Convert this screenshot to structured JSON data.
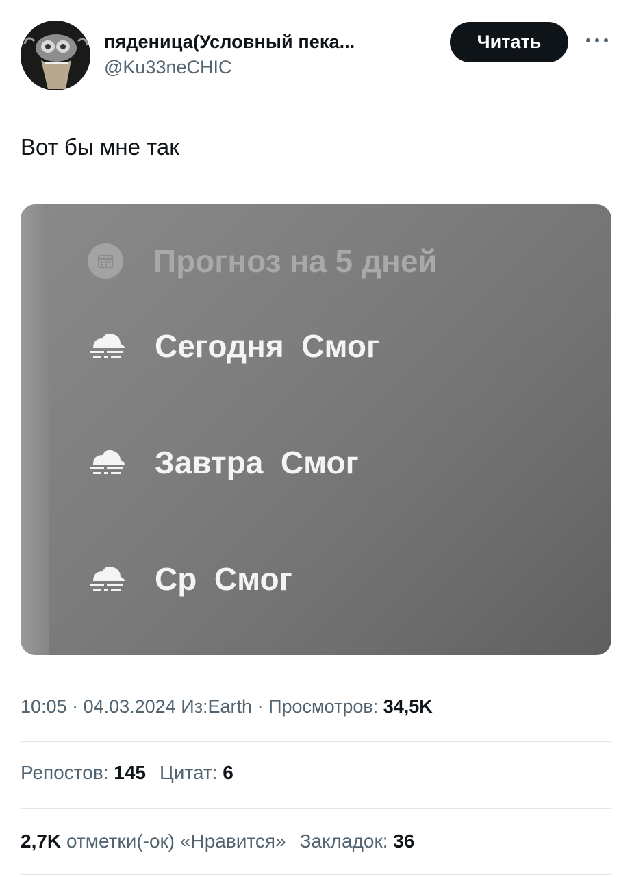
{
  "author": {
    "display_name": "пяденица(Условный пека...",
    "handle": "@Ku33neCHIC"
  },
  "follow_label": "Читать",
  "tweet_text": "Вот бы мне так",
  "media": {
    "title": "Прогноз на 5 дней",
    "days": [
      {
        "day": "Сегодня",
        "condition": "Смог",
        "icon": "fog-icon"
      },
      {
        "day": "Завтра",
        "condition": "Смог",
        "icon": "fog-icon"
      },
      {
        "day": "Ср",
        "condition": "Смог",
        "icon": "fog-icon"
      }
    ],
    "header_icon": "calendar-icon"
  },
  "meta": {
    "time": "10:05",
    "date": "04.03.2024",
    "source": "Из:Earth",
    "views_label": "Просмотров:",
    "views": "34,5K"
  },
  "stats": {
    "reposts_label": "Репостов:",
    "reposts": "145",
    "quotes_label": "Цитат:",
    "quotes": "6",
    "likes": "2,7K",
    "likes_label": "отметки(-ок) «Нравится»",
    "bookmarks_label": "Закладок:",
    "bookmarks": "36"
  }
}
